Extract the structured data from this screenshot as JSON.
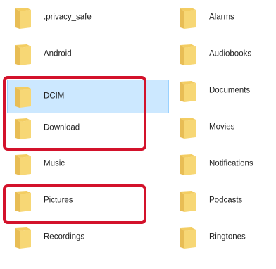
{
  "folders_left": [
    {
      "label": ".privacy_safe",
      "icon": "folder-icon",
      "selected": false
    },
    {
      "label": "Android",
      "icon": "folder-icon",
      "selected": false
    },
    {
      "label": "DCIM",
      "icon": "folder-icon",
      "selected": true
    },
    {
      "label": "Download",
      "icon": "folder-icon",
      "selected": false
    },
    {
      "label": "Music",
      "icon": "folder-icon",
      "selected": false
    },
    {
      "label": "Pictures",
      "icon": "folder-icon",
      "selected": false
    },
    {
      "label": "Recordings",
      "icon": "folder-icon",
      "selected": false
    }
  ],
  "folders_right": [
    {
      "label": "Alarms",
      "icon": "folder-icon"
    },
    {
      "label": "Audiobooks",
      "icon": "folder-icon"
    },
    {
      "label": "Documents",
      "icon": "folder-icon"
    },
    {
      "label": "Movies",
      "icon": "folder-icon"
    },
    {
      "label": "Notifications",
      "icon": "folder-icon"
    },
    {
      "label": "Podcasts",
      "icon": "folder-icon"
    },
    {
      "label": "Ringtones",
      "icon": "folder-icon"
    }
  ],
  "colors": {
    "selection_bg": "#cce8ff",
    "selection_border": "#99d1ff",
    "highlight": "#d3122b",
    "folder_front": "#f7d775",
    "folder_back": "#e8bd55"
  }
}
